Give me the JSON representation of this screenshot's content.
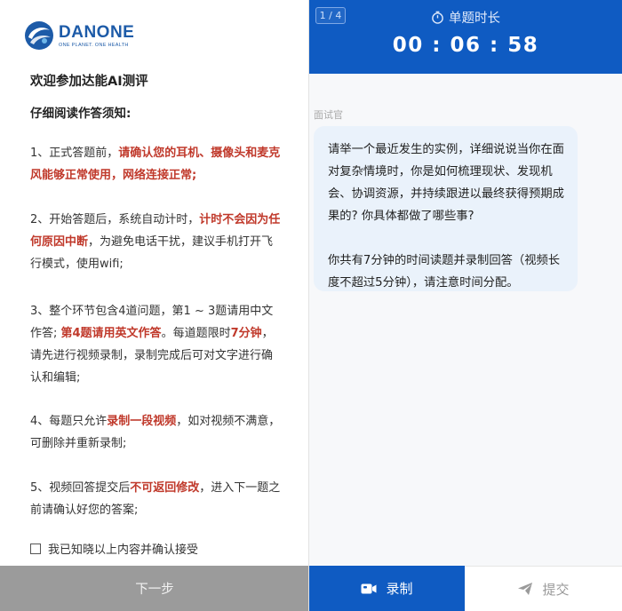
{
  "brand": {
    "name": "DANONE",
    "tagline": "ONE PLANET. ONE HEALTH",
    "primary_color": "#1d5ba8"
  },
  "instructions": {
    "welcome": "欢迎参加达能AI测评",
    "subhead": "仔细阅读作答须知:",
    "rule1": [
      {
        "t": "1、正式答题前，",
        "red": false
      },
      {
        "t": "请确认您的耳机、摄像头和麦克风能够正常使用，网络连接正常;",
        "red": true
      }
    ],
    "rule2": [
      {
        "t": "2、开始答题后，系统自动计时，",
        "red": false
      },
      {
        "t": "计时不会因为任何原因中断",
        "red": true
      },
      {
        "t": "，为避免电话干扰，建议手机打开飞行模式，使用wifi;",
        "red": false
      }
    ],
    "rule3": [
      {
        "t": "3、整个环节包含4道问题，第1 ~ 3题请用中文作答; ",
        "red": false
      },
      {
        "t": "第4题请用英文作答",
        "red": true
      },
      {
        "t": "。每道题限时",
        "red": false
      },
      {
        "t": "7分钟",
        "red": true
      },
      {
        "t": "，请先进行视频录制，录制完成后可对文字进行确认和编辑;",
        "red": false
      }
    ],
    "rule4": [
      {
        "t": "4、每题只允许",
        "red": false
      },
      {
        "t": "录制一段视频",
        "red": true
      },
      {
        "t": "，如对视频不满意，可删除并重新录制;",
        "red": false
      }
    ],
    "rule5": [
      {
        "t": "5、视频回答提交后",
        "red": false
      },
      {
        "t": "不可返回修改",
        "red": true
      },
      {
        "t": "，进入下一题之前请确认好您的答案;",
        "red": false
      }
    ],
    "agree_label": "我已知晓以上内容并确认接受",
    "agree_checked": false,
    "next_label": "下一步"
  },
  "question": {
    "progress": "1 / 4",
    "timer_label": "单题时长",
    "timer_value": "00 : 06 : 58",
    "role": "面试官",
    "text1": "请举一个最近发生的实例，详细说说当你在面对复杂情境时，你是如何梳理现状、发现机会、协调资源，并持续跟进以最终获得预期成果的? 你具体都做了哪些事?",
    "text2": "你共有7分钟的时间读题并录制回答（视频长度不超过5分钟），请注意时间分配。",
    "record_label": "录制",
    "submit_label": "提交"
  },
  "colors": {
    "accent_blue": "#0f5bc2",
    "emphasis_red": "#c0392b",
    "disabled_gray": "#9b9b9b",
    "bubble_bg": "#eaf2fb"
  },
  "icons": {
    "logo": "danone-logo-icon",
    "timer": "stopwatch-icon",
    "record": "video-camera-icon",
    "submit": "send-plane-icon",
    "checkbox": "checkbox-icon"
  }
}
